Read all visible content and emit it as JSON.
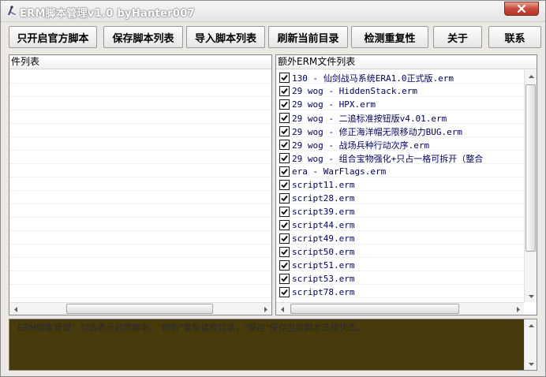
{
  "window": {
    "title": "ERM脚本管理v1.0  byHanter007",
    "close_icon": "close-icon"
  },
  "toolbar": {
    "buttons": [
      "只开启官方脚本",
      "保存脚本列表",
      "导入脚本列表",
      "刷新当前目录",
      "检测重复性",
      "关于",
      "联系"
    ]
  },
  "left_panel": {
    "header": "件列表"
  },
  "right_panel": {
    "header": "额外ERM文件列表",
    "items": [
      "130 - 仙剑战马系统ERA1.0正式版.erm",
      "29 wog - HiddenStack.erm",
      "29 wog - HPX.erm",
      "29 wog - 二追标准按钮版v4.01.erm",
      "29 wog - 修正海洋帽无限移动力BUG.erm",
      "29 wog - 战场兵种行动次序.erm",
      "29 wog - 组合宝物强化+只占一格可拆开（整合",
      "era - WarFlags.erm",
      "script11.erm",
      "script28.erm",
      "script39.erm",
      "script44.erm",
      "script49.erm",
      "script50.erm",
      "script51.erm",
      "script53.erm",
      "script78.erm"
    ]
  },
  "log": {
    "message": "ERM脚本管理：勾选表示启用脚本，\"刷新\"重新读取目录，\"保存\"保存当前脚本选择状态。"
  }
}
